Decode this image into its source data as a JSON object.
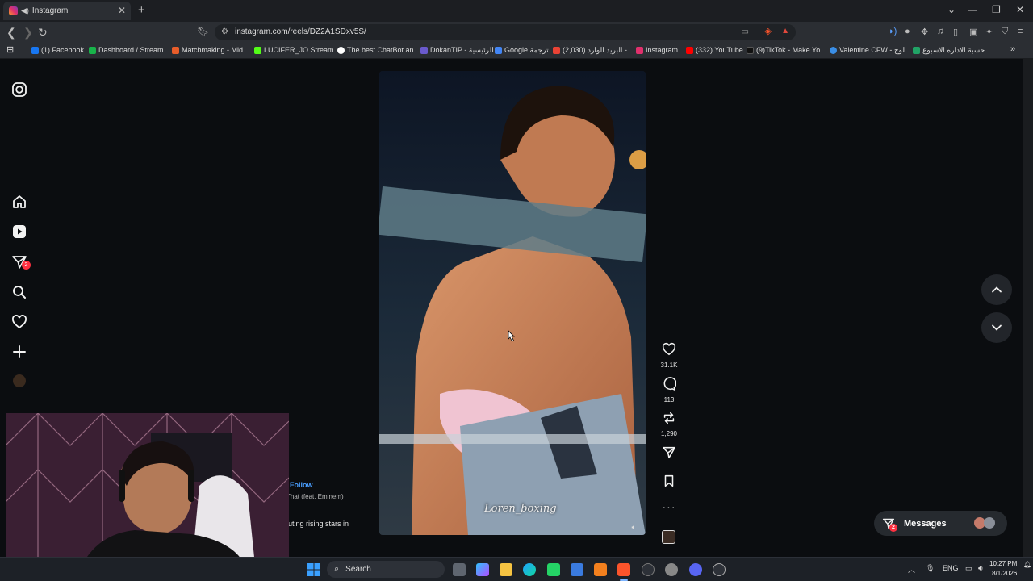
{
  "browser": {
    "tab_title": "Instagram",
    "url": "instagram.com/reels/DZ2A1SDxv5S/",
    "bookmarks": [
      "(1) Facebook",
      "Dashboard / Stream...",
      "Matchmaking - Mid...",
      "LUCIFER_JO Stream...",
      "The best ChatBot an...",
      "DokanTIP - الرئيسية",
      "Google ترجمة",
      "(2,030) البريد الوارد -...",
      "Instagram",
      "(332) YouTube",
      "(9)TikTok - Make Yo...",
      "Valentine CFW - لوح...",
      "حسبة الاداره الاسبوع"
    ],
    "bookmark_colors": [
      "#1877f2",
      "#18b34a",
      "#e85d2a",
      "#53fc18",
      "#ffffff",
      "#6a5acd",
      "#4285f4",
      "#ea4335",
      "#e1306c",
      "#ff0000",
      "#111111",
      "#3a8ee6",
      "#21a366"
    ]
  },
  "sidebar": {
    "notifications_badge": "2"
  },
  "reel": {
    "watermark": "Loren_boxing",
    "likes": "31.1K",
    "comments": "113",
    "reposts": "1,290",
    "follow_label": "Follow",
    "song": "That (feat. Eminem)",
    "caption": "uting rising stars in"
  },
  "messages": {
    "label": "Messages",
    "badge": "2"
  },
  "taskbar": {
    "search_placeholder": "Search",
    "language": "ENG",
    "time": "10:27 PM",
    "date": "8/1/2026"
  }
}
